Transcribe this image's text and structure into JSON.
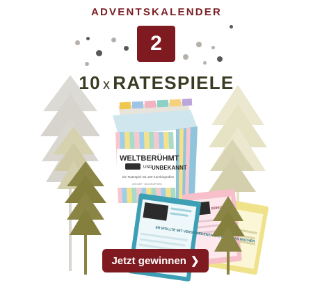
{
  "header": {
    "kicker": "ADVENTSKALENDER",
    "day_number": "2",
    "headline_count": "10",
    "headline_x": "x",
    "headline_text": "RATESPIELE"
  },
  "product": {
    "title_line1": "WELTBERÜHMT",
    "title_und": "UND",
    "title_line2": "UNBEKANNT",
    "subtitle": "Ein Ratespiel mit 100 Kurzbiografien",
    "brand": "ATELIER · BIGGRAPHIEN"
  },
  "cards": {
    "front_text": "ER WOLLTE MIT VERSCHIEDENEN DATEN ETWAS MACHEN",
    "mid_label": "EDISON"
  },
  "cta": {
    "label": "Jetzt gewinnen",
    "icon": "chevron-right-icon",
    "color": "#7f1b20"
  },
  "colors": {
    "accent": "#7f1b20",
    "headline": "#3b3b24"
  }
}
